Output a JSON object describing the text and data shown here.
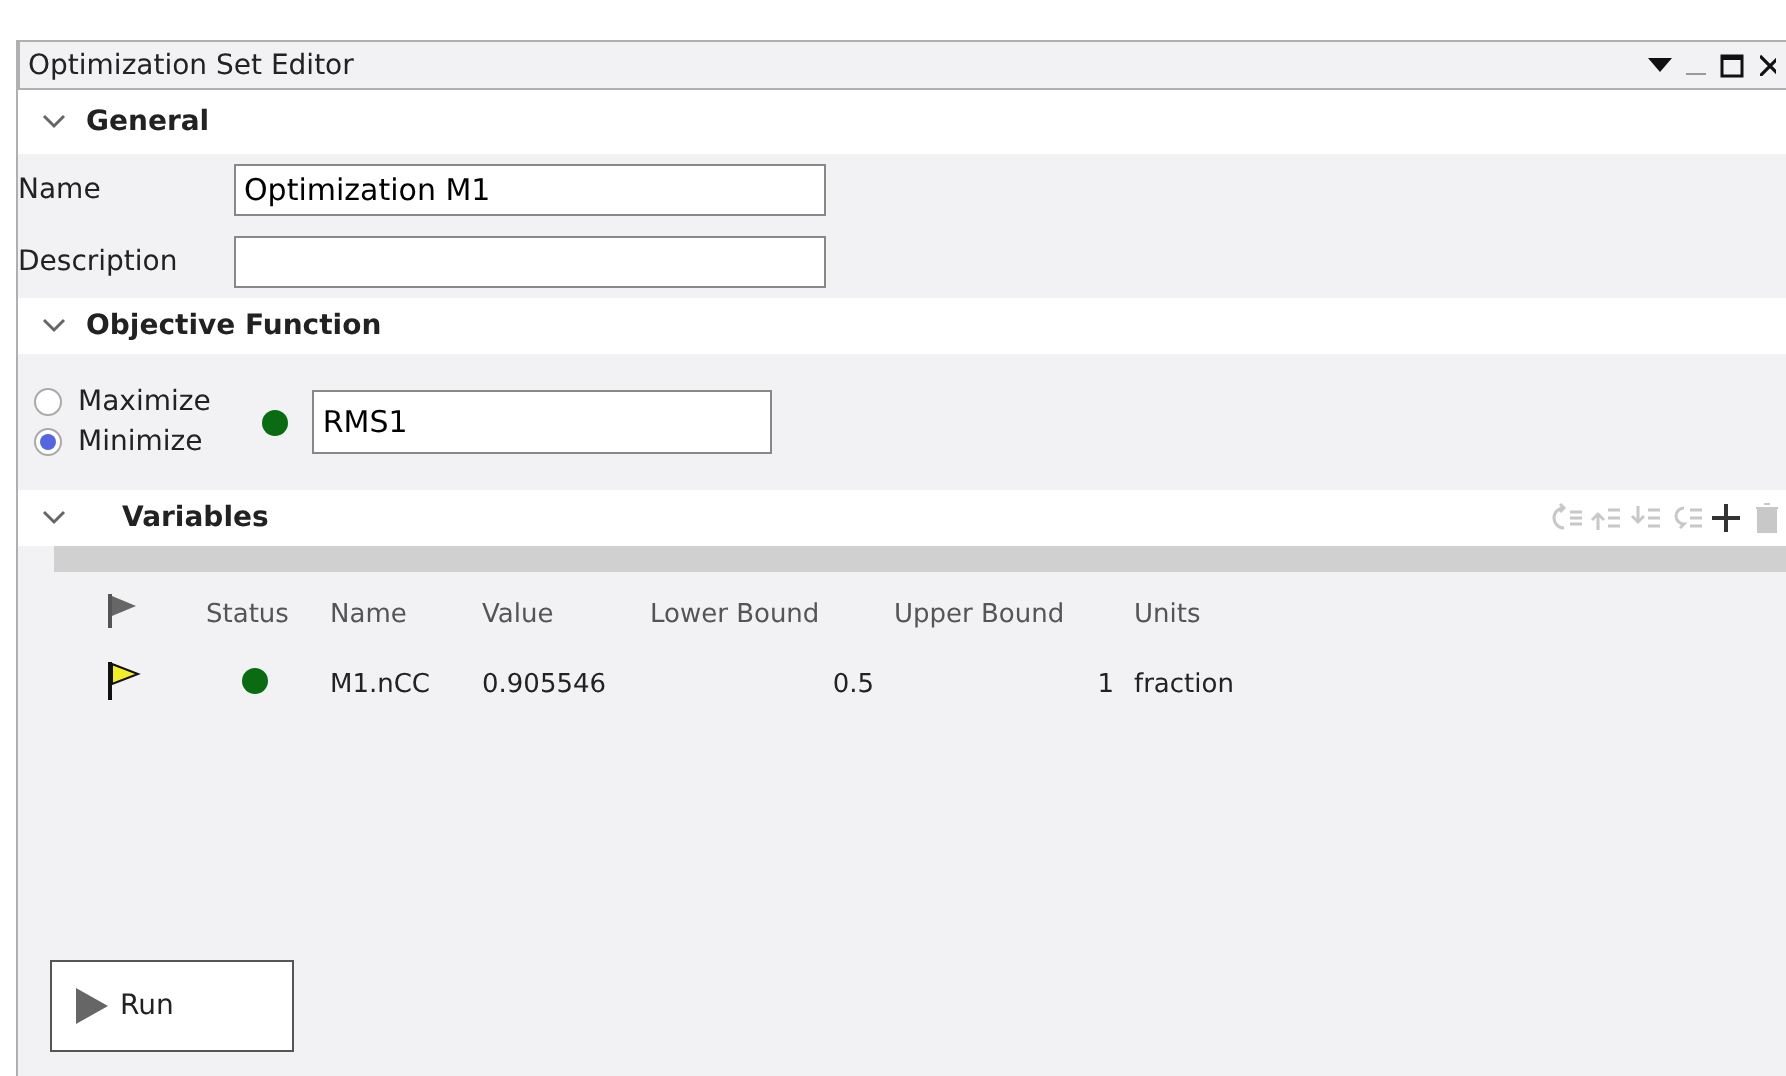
{
  "window": {
    "title": "Optimization Set Editor"
  },
  "general": {
    "title": "General",
    "expanded": true,
    "fields": [
      {
        "label": "Name",
        "value": "Optimization M1"
      },
      {
        "label": "Description"
      }
    ]
  },
  "objective": {
    "title": "Objective Function",
    "expanded": true,
    "options": [
      {
        "label": "Maximize",
        "selected": false
      },
      {
        "label": "Minimize",
        "selected": true
      }
    ],
    "function": "RMS1"
  },
  "variables": {
    "title": "Variables",
    "expanded": true,
    "toolbar": [
      {
        "kind": "insert",
        "disabled": true
      },
      {
        "kind": "up",
        "disabled": true
      },
      {
        "kind": "down",
        "disabled": true
      },
      {
        "kind": "remove",
        "disabled": true
      },
      {
        "kind": "add",
        "disabled": false
      },
      {
        "kind": "delete",
        "disabled": true
      }
    ],
    "columns": [
      {
        "kind": "flag"
      },
      {
        "kind": "text",
        "label": "Status"
      },
      {
        "kind": "text",
        "label": "Name"
      },
      {
        "kind": "text",
        "label": "Value"
      },
      {
        "kind": "text",
        "label": "Lower Bound"
      },
      {
        "kind": "text",
        "label": "Upper Bound"
      },
      {
        "kind": "text",
        "label": "Units"
      }
    ],
    "rows": [
      {
        "cells": [
          {
            "kind": "flag",
            "flagged": true
          },
          {
            "kind": "status"
          },
          {
            "kind": "text",
            "text": "M1.nCC"
          },
          {
            "kind": "text",
            "text": "0.905546"
          },
          {
            "kind": "number",
            "text": "0.5"
          },
          {
            "kind": "number",
            "text": "1"
          },
          {
            "kind": "text",
            "text": "fraction"
          }
        ]
      }
    ]
  },
  "run_button": "Run"
}
